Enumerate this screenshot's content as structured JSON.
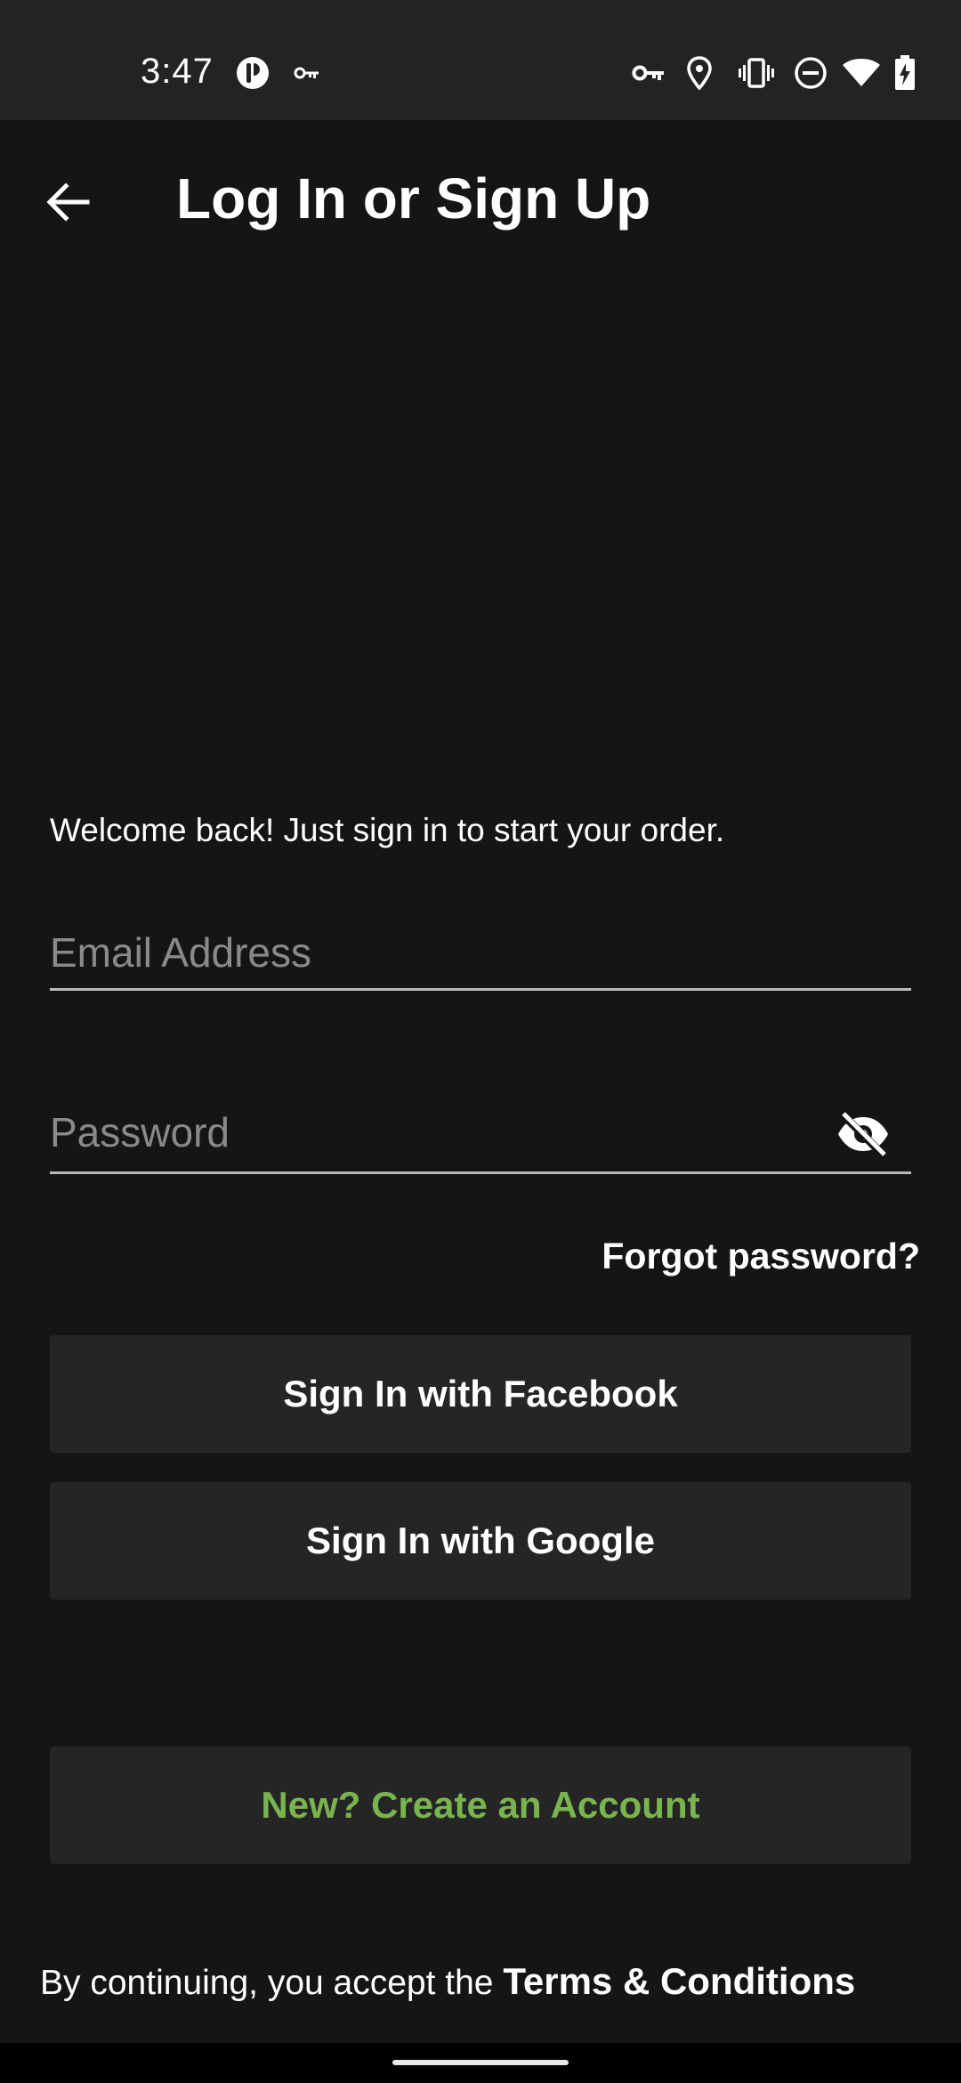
{
  "status_bar": {
    "time": "3:47",
    "icons": [
      "notification-app-icon",
      "vpn-key-icon",
      "key-icon",
      "location-icon",
      "vibrate-icon",
      "do-not-disturb-icon",
      "wifi-icon",
      "battery-charging-icon"
    ]
  },
  "header": {
    "back_icon": "arrow-back-icon",
    "title": "Log In or Sign Up"
  },
  "form": {
    "welcome": "Welcome back! Just sign in to start your order.",
    "email": {
      "placeholder": "Email Address",
      "value": ""
    },
    "password": {
      "placeholder": "Password",
      "value": "",
      "toggle_icon": "eye-off-icon"
    },
    "forgot_password": "Forgot password?"
  },
  "buttons": {
    "facebook": "Sign In with Facebook",
    "google": "Sign In with Google",
    "create_account": "New? Create an Account"
  },
  "footer": {
    "terms_prefix": "By continuing, you accept the ",
    "terms_link": "Terms & Conditions"
  },
  "colors": {
    "background": "#151515",
    "status_bar": "#232323",
    "button": "#252525",
    "accent_green": "#7ab44f",
    "underline": "#b9b9b9"
  }
}
